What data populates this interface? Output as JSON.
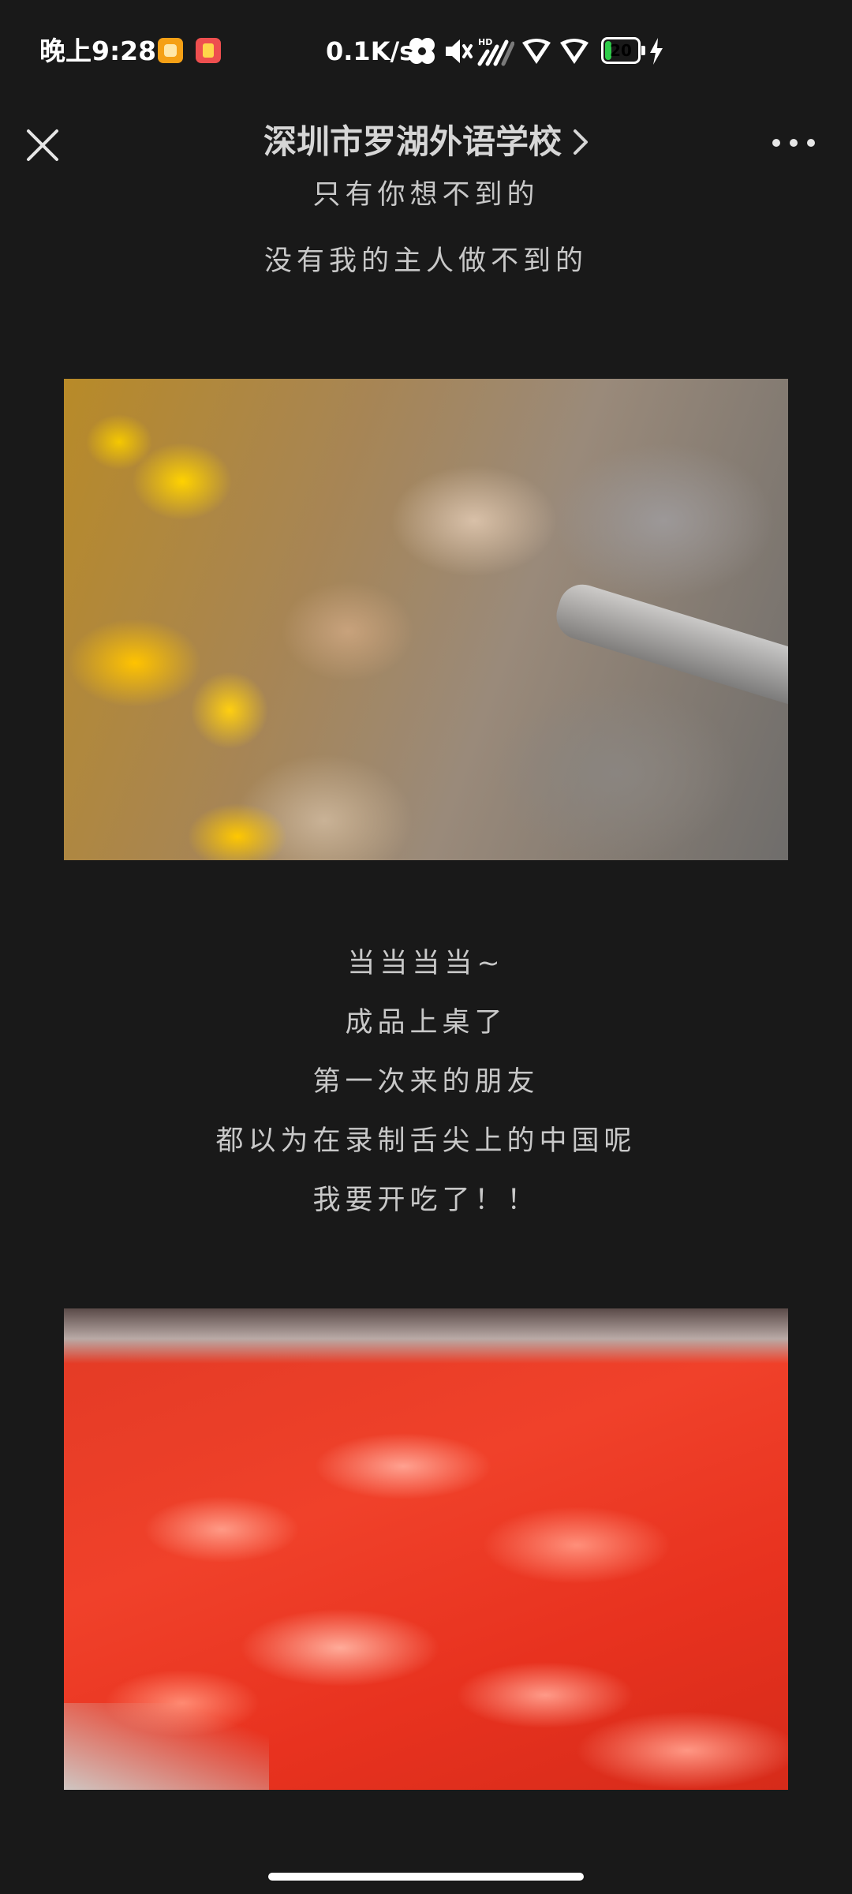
{
  "status_bar": {
    "time": "晚上9:28",
    "network_speed": "0.1K/s",
    "battery_level": "20",
    "battery_fill": 0.2,
    "icons": [
      "notification-app-icon",
      "notification-app-icon",
      "bluetooth-icon",
      "mute-icon",
      "hd-signal-icon",
      "shield-icon",
      "shield-icon",
      "battery-icon",
      "charging-bolt-icon"
    ],
    "battery_color": "#2ecc4a"
  },
  "nav": {
    "close_icon": "close-icon",
    "title": "深圳市罗湖外语学校",
    "title_chevron_icon": "chevron-right-icon",
    "more_icon": "more-dots-icon"
  },
  "article": {
    "intro_lines": [
      "只有你想不到的",
      "没有我的主人做不到的"
    ],
    "image_1": "cooking-food-image",
    "middle_lines": [
      "当当当当~",
      "成品上桌了",
      "第一次来的朋友",
      "都以为在录制舌尖上的中国呢",
      "我要开吃了！！"
    ],
    "image_2": "shrimp-tray-image"
  },
  "colors": {
    "background": "#191919",
    "text": "#c8c8c8",
    "title": "#d6d6d6"
  }
}
